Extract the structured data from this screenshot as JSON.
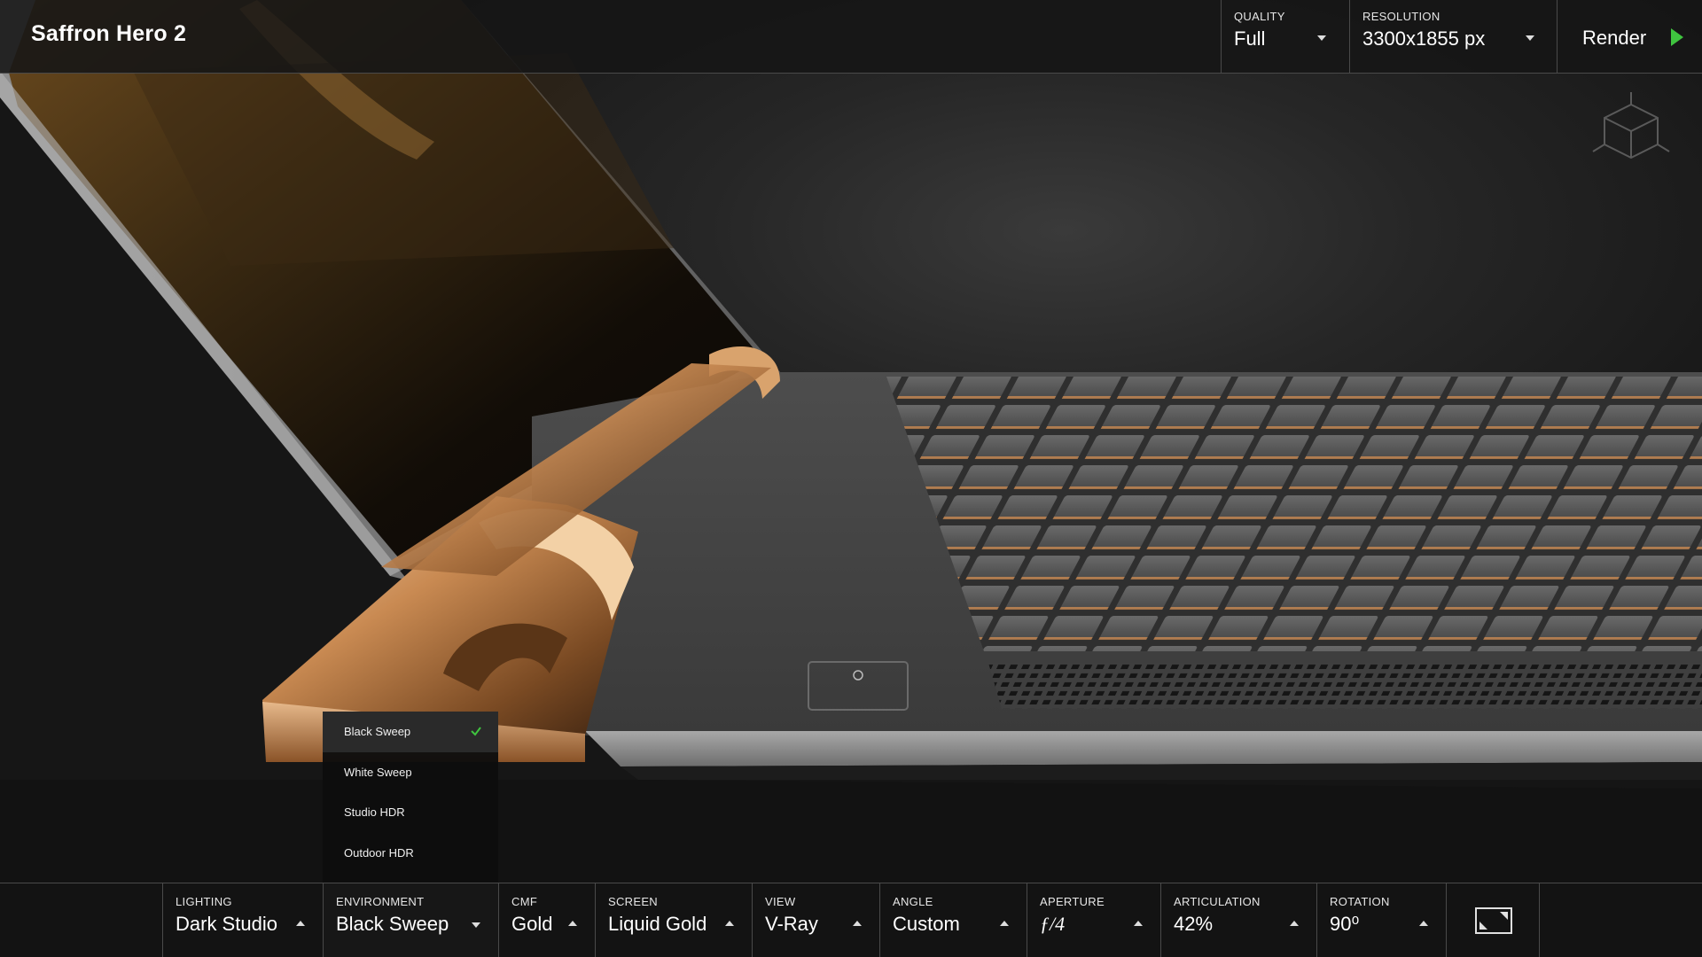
{
  "app": {
    "title": "Saffron Hero 2"
  },
  "topbar": {
    "quality": {
      "label": "QUALITY",
      "value": "Full"
    },
    "resolution": {
      "label": "RESOLUTION",
      "value": "3300x1855 px"
    },
    "render_label": "Render"
  },
  "environment_menu": {
    "items": [
      {
        "label": "Black Sweep",
        "selected": true
      },
      {
        "label": "White Sweep",
        "selected": false
      },
      {
        "label": "Studio HDR",
        "selected": false
      },
      {
        "label": "Outdoor HDR",
        "selected": false
      }
    ]
  },
  "bottombar": {
    "lighting": {
      "label": "LIGHTING",
      "value": "Dark Studio"
    },
    "environment": {
      "label": "ENVIRONMENT",
      "value": "Black Sweep"
    },
    "cmf": {
      "label": "CMF",
      "value": "Gold"
    },
    "screen": {
      "label": "SCREEN",
      "value": "Liquid Gold"
    },
    "view": {
      "label": "VIEW",
      "value": "V-Ray"
    },
    "angle": {
      "label": "ANGLE",
      "value": "Custom"
    },
    "aperture": {
      "label": "APERTURE",
      "value": "ƒ/4"
    },
    "articulation": {
      "label": "ARTICULATION",
      "value": "42%"
    },
    "rotation": {
      "label": "ROTATION",
      "value": "90⁰"
    }
  },
  "icons": {
    "render": "play-icon",
    "view_cube": "view-cube-icon",
    "fullscreen": "fullscreen-icon",
    "selected": "check-icon"
  },
  "colors": {
    "accent_green": "#3fc43f",
    "gold": "#c98a52",
    "bar_background": "#161616",
    "divider": "#4a4a4a"
  }
}
